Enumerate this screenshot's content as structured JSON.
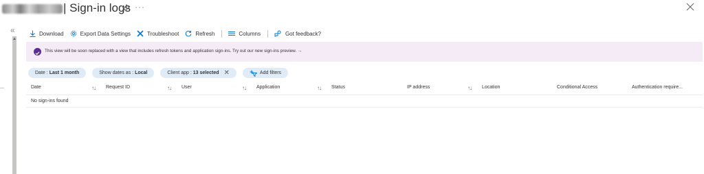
{
  "header": {
    "title": "| Sign-in logs",
    "ellipsis": "···",
    "icons": {
      "pin": "pin-icon",
      "close": "close-icon"
    }
  },
  "rail": {
    "collapse": "«"
  },
  "toolbar": {
    "items": [
      {
        "label": "Download",
        "icon": "download-icon"
      },
      {
        "label": "Export Data Settings",
        "icon": "gear-icon"
      },
      {
        "label": "Troubleshoot",
        "icon": "wrench-icon"
      },
      {
        "label": "Refresh",
        "icon": "refresh-icon"
      },
      {
        "label": "Columns",
        "icon": "columns-icon"
      },
      {
        "label": "Got feedback?",
        "icon": "feedback-icon"
      }
    ]
  },
  "banner": {
    "text": "This view will be soon replaced with a view that includes refresh tokens and application sign-ins. Try out our new sign-ins preview.",
    "arrow": "→",
    "color": "#f4ebf6",
    "icon_color": "#5c2d91"
  },
  "filters": {
    "date": {
      "label": "Date :",
      "value": "Last 1 month"
    },
    "show_dates": {
      "label": "Show dates as :",
      "value": "Local"
    },
    "client_app": {
      "label": "Client app :",
      "value": "13 selected",
      "remove": "✕"
    },
    "add": "Add filters",
    "pill_color": "#dfecf7"
  },
  "table": {
    "columns": [
      {
        "label": "Date",
        "sortable": true
      },
      {
        "label": "Request ID",
        "sortable": true
      },
      {
        "label": "User",
        "sortable": true
      },
      {
        "label": "Application",
        "sortable": true
      },
      {
        "label": "Status",
        "sortable": false
      },
      {
        "label": "IP address",
        "sortable": true
      },
      {
        "label": "Location",
        "sortable": false
      },
      {
        "label": "Conditional Access",
        "sortable": false
      },
      {
        "label": "Authentication require...",
        "sortable": false
      }
    ],
    "sort_glyph": "↑↓",
    "empty_text": "No sign-ins found"
  },
  "colors": {
    "accent": "#0078d4",
    "text": "#323130"
  }
}
